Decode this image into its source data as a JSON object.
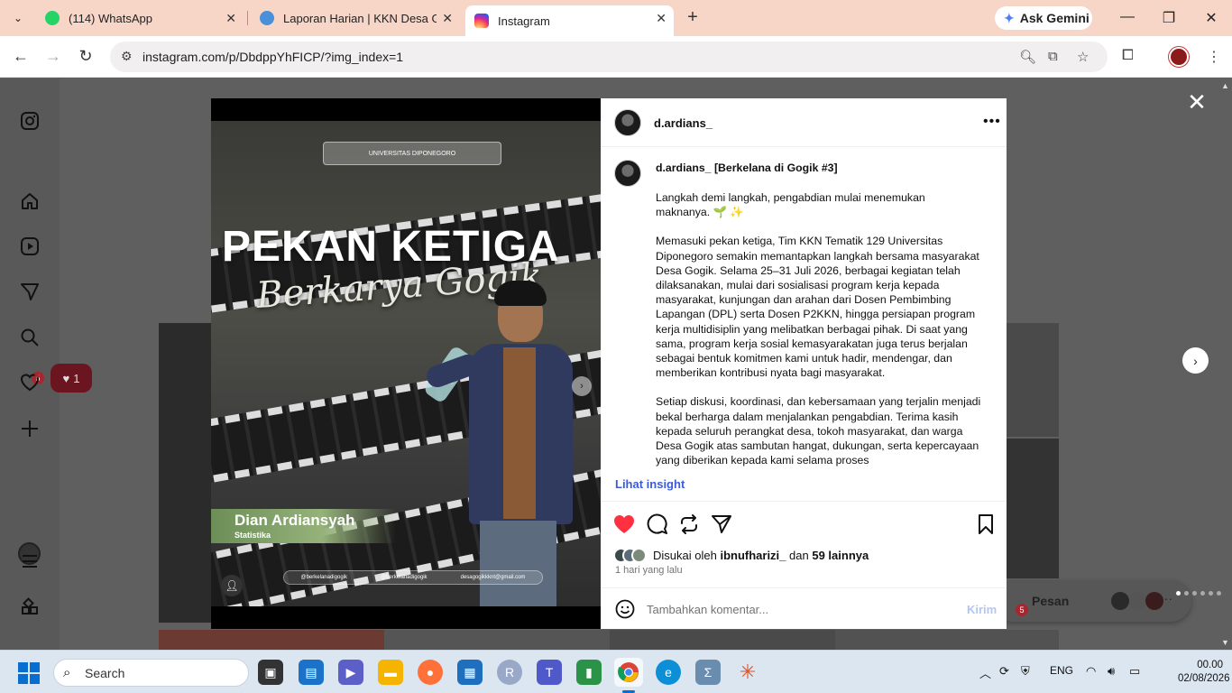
{
  "browser": {
    "tabs": [
      {
        "label": "(114) WhatsApp",
        "favicon_color": "#25d366"
      },
      {
        "label": "Laporan Harian | KKN Desa Gog",
        "favicon_color": "#4a90d9"
      },
      {
        "label": "Instagram",
        "favicon_color": "#d6249f",
        "active": true
      }
    ],
    "gemini_label": "Ask Gemini",
    "url": "instagram.com/p/DbdppYhFICP/?img_index=1"
  },
  "sidebar": {
    "notification_badge": "5",
    "heart_count": "1"
  },
  "image": {
    "logo_text": "UNIVERSITAS DIPONEGORO",
    "headline": "PEKAN KETIGA",
    "script_title": "Berkarya Gogik",
    "person_name": "Dian Ardiansyah",
    "person_major": "Statistika",
    "footer_links": [
      "@berkelanadigogik",
      "@berkelanadigogik",
      "desagogikkknt@gmail.com"
    ],
    "carousel_total": 6,
    "carousel_index": 1
  },
  "post": {
    "username": "d.ardians_",
    "caption_title": "[Berkelana di Gogik #3]",
    "caption_paragraphs": [
      "Langkah demi langkah, pengabdian mulai menemukan maknanya. 🌱 ✨",
      "Memasuki pekan ketiga, Tim KKN Tematik 129 Universitas Diponegoro semakin memantapkan langkah bersama masyarakat Desa Gogik. Selama 25–31 Juli 2026, berbagai kegiatan telah dilaksanakan, mulai dari sosialisasi program kerja kepada masyarakat, kunjungan dan arahan dari Dosen Pembimbing Lapangan (DPL) serta Dosen P2KKN, hingga persiapan program kerja multidisiplin yang melibatkan berbagai pihak. Di saat yang sama, program kerja sosial kemasyarakatan juga terus berjalan sebagai bentuk komitmen kami untuk hadir, mendengar, dan memberikan kontribusi nyata bagi masyarakat.",
      "Setiap diskusi, koordinasi, dan kebersamaan yang terjalin menjadi bekal berharga dalam menjalankan pengabdian. Terima kasih kepada seluruh perangkat desa, tokoh masyarakat, dan warga Desa Gogik atas sambutan hangat, dukungan, serta kepercayaan yang diberikan kepada kami selama proses"
    ],
    "insight_label": "Lihat insight",
    "likes_prefix": "Disukai oleh",
    "likes_user": "ibnufharizi_",
    "likes_and": "dan",
    "likes_others": "59 lainnya",
    "time_ago": "1 hari yang lalu",
    "comment_placeholder": "Tambahkan komentar...",
    "send_label": "Kirim"
  },
  "messages": {
    "label": "Pesan",
    "badge": "5"
  },
  "taskbar": {
    "search_label": "Search",
    "language": "ENG",
    "time": "00.00",
    "date": "02/08/2026"
  }
}
